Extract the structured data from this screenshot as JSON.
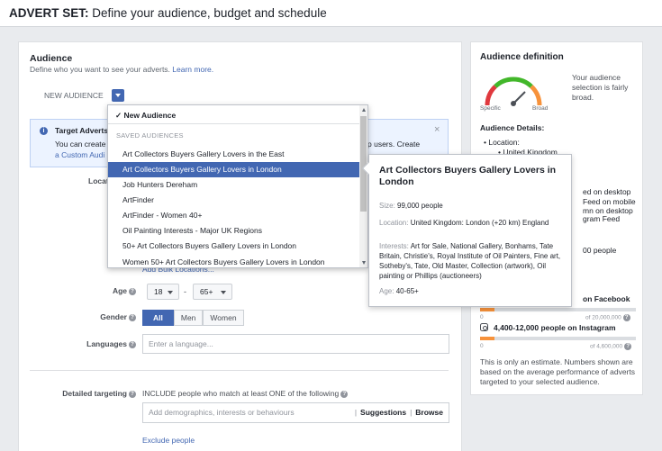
{
  "header": {
    "title_bold": "ADVERT SET:",
    "title_rest": " Define your audience, budget and schedule"
  },
  "audience": {
    "heading": "Audience",
    "subtitle": "Define who you want to see your adverts.",
    "learn_more": "Learn more.",
    "new_audience_label": "NEW AUDIENCE"
  },
  "info_box": {
    "title": "Target Adverts",
    "line1_start": "You can create",
    "line1_end": "p users. Create",
    "line2": "a Custom Audi",
    "close": "×"
  },
  "dropdown": {
    "new_audience": "✓ New Audience",
    "section_label": "SAVED AUDIENCES",
    "items": [
      "Art Collectors Buyers Gallery Lovers in the East",
      "Art Collectors Buyers Gallery Lovers in London",
      "Job Hunters Dereham",
      "ArtFinder",
      "ArtFinder - Women 40+",
      "Oil Painting Interests - Major UK Regions",
      "50+ Art Collectors Buyers Gallery Lovers in London",
      "Women 50+ Art Collectors Buyers Gallery Lovers in London"
    ],
    "highlighted_index": 1
  },
  "tooltip": {
    "title": "Art Collectors Buyers Gallery Lovers in London",
    "size_key": "Size:",
    "size_val": "99,000 people",
    "location_key": "Location:",
    "location_val": "United Kingdom: London (+20 km) England",
    "interests_key": "Interests:",
    "interests_val": "Art for Sale, National Gallery, Bonhams, Tate Britain, Christie's, Royal Institute of Oil Painters, Fine art, Sotheby's, Tate, Old Master, Collection (artwork), Oil painting or Phillips (auctioneers)",
    "age_key": "Age:",
    "age_val": "40-65+"
  },
  "form": {
    "locations_label": "Locat",
    "add_bulk": "Add Bulk Locations...",
    "age_label": "Age",
    "age_min": "18",
    "age_max": "65+",
    "gender_label": "Gender",
    "gender_all": "All",
    "gender_men": "Men",
    "gender_women": "Women",
    "languages_label": "Languages",
    "languages_placeholder": "Enter a language...",
    "detailed_label": "Detailed targeting",
    "include_text": "INCLUDE people who match at least ONE of the following",
    "detailed_placeholder": "Add demographics, interests or behaviours",
    "suggestions": "Suggestions",
    "browse": "Browse",
    "separator": "|",
    "exclude": "Exclude people"
  },
  "sidebar": {
    "heading": "Audience definition",
    "gauge_specific": "Specific",
    "gauge_broad": "Broad",
    "description": "Your audience selection is fairly broad.",
    "details_heading": "Audience Details:",
    "bullet_location": "Location:",
    "bullet_uk": "United Kingdom",
    "frag1": "ed on desktop",
    "frag2": "Feed on mobile",
    "frag3": "mn on desktop",
    "frag4": "gram Feed",
    "frag5": "00 people",
    "frag6": "on Facebook",
    "fb_min": "0",
    "fb_max": "of 20,000,000",
    "instagram": "4,400-12,000 people on Instagram",
    "ig_min": "0",
    "ig_max": "of 4,600,000",
    "note": "This is only an estimate. Numbers shown are based on the average performance of adverts targeted to your selected audience."
  },
  "colors": {
    "brand_blue": "#4267b2",
    "highlight": "#4267b2",
    "bar_orange": "#f7923b"
  }
}
